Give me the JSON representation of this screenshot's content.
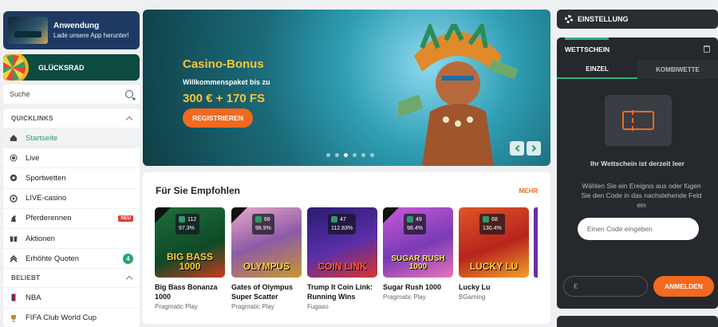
{
  "app_promo": {
    "title": "Anwendung",
    "subtitle": "Lade unsere App herunter!"
  },
  "wheel": {
    "label": "GLÜCKSRAD"
  },
  "search": {
    "placeholder": "Suche"
  },
  "quicklinks": {
    "heading": "QUICKLINKS",
    "items": [
      {
        "label": "Startseite",
        "icon": "home-icon",
        "active": true
      },
      {
        "label": "Live",
        "icon": "live-icon"
      },
      {
        "label": "Sportwetten",
        "icon": "soccer-ball-icon"
      },
      {
        "label": "LIVE-casino",
        "icon": "chip-icon"
      },
      {
        "label": "Pferderennen",
        "icon": "horse-icon",
        "badge": "NEU"
      },
      {
        "label": "Aktionen",
        "icon": "gift-icon"
      },
      {
        "label": "Erhöhte Quoten",
        "icon": "boost-icon",
        "count": "4"
      }
    ]
  },
  "popular": {
    "heading": "BELIEBT",
    "items": [
      {
        "label": "NBA",
        "icon": "nba-icon"
      },
      {
        "label": "FIFA Club World Cup",
        "icon": "trophy-icon"
      }
    ]
  },
  "banner": {
    "title": "Casino-Bonus",
    "subtitle": "Willkommenspaket bis zu",
    "amount": "300 € + 170 FS",
    "cta": "REGISTRIEREN"
  },
  "recommended": {
    "title": "Für Sie Empfohlen",
    "more": "MEHR",
    "games": [
      {
        "name": "Big Bass Bonanza 1000",
        "provider": "Pragmatic Play",
        "players": "112",
        "rtp": "97.3%",
        "logo": "BIG BASS 1000"
      },
      {
        "name": "Gates of Olympus Super Scatter",
        "provider": "Pragmatic Play",
        "players": "68",
        "rtp": "98.9%",
        "logo": "OLYMPUS"
      },
      {
        "name": "Trump It Coin Link: Running Wins",
        "provider": "Fugaso",
        "players": "47",
        "rtp": "112.83%",
        "logo": "COIN LINK"
      },
      {
        "name": "Sugar Rush 1000",
        "provider": "Pragmatic Play",
        "players": "49",
        "rtp": "98.4%",
        "logo": "SUGAR RUSH 1000"
      },
      {
        "name": "Lucky Lu",
        "provider": "BGaming",
        "players": "68",
        "rtp": "130.4%",
        "logo": "LUCKY LU"
      }
    ]
  },
  "settings": {
    "label": "EINSTELLUNG"
  },
  "betslip": {
    "title": "WETTSCHEIN",
    "tabs": [
      "EINZEL",
      "KOMBIWETTE"
    ],
    "empty_title": "Ihr Wettschein ist derzeit leer",
    "empty_text": "Wählen Sie ein Ereignis aus oder fügen Sie den Code in das nachstehende Feld ein",
    "code_placeholder": "Einen Code eingeben",
    "stake_currency": "€",
    "place_label": "ANMELDEN"
  },
  "colors": {
    "accent": "#f3691f",
    "green": "#2c9b6a",
    "navy": "#1e3a63",
    "dark": "#25282c"
  }
}
